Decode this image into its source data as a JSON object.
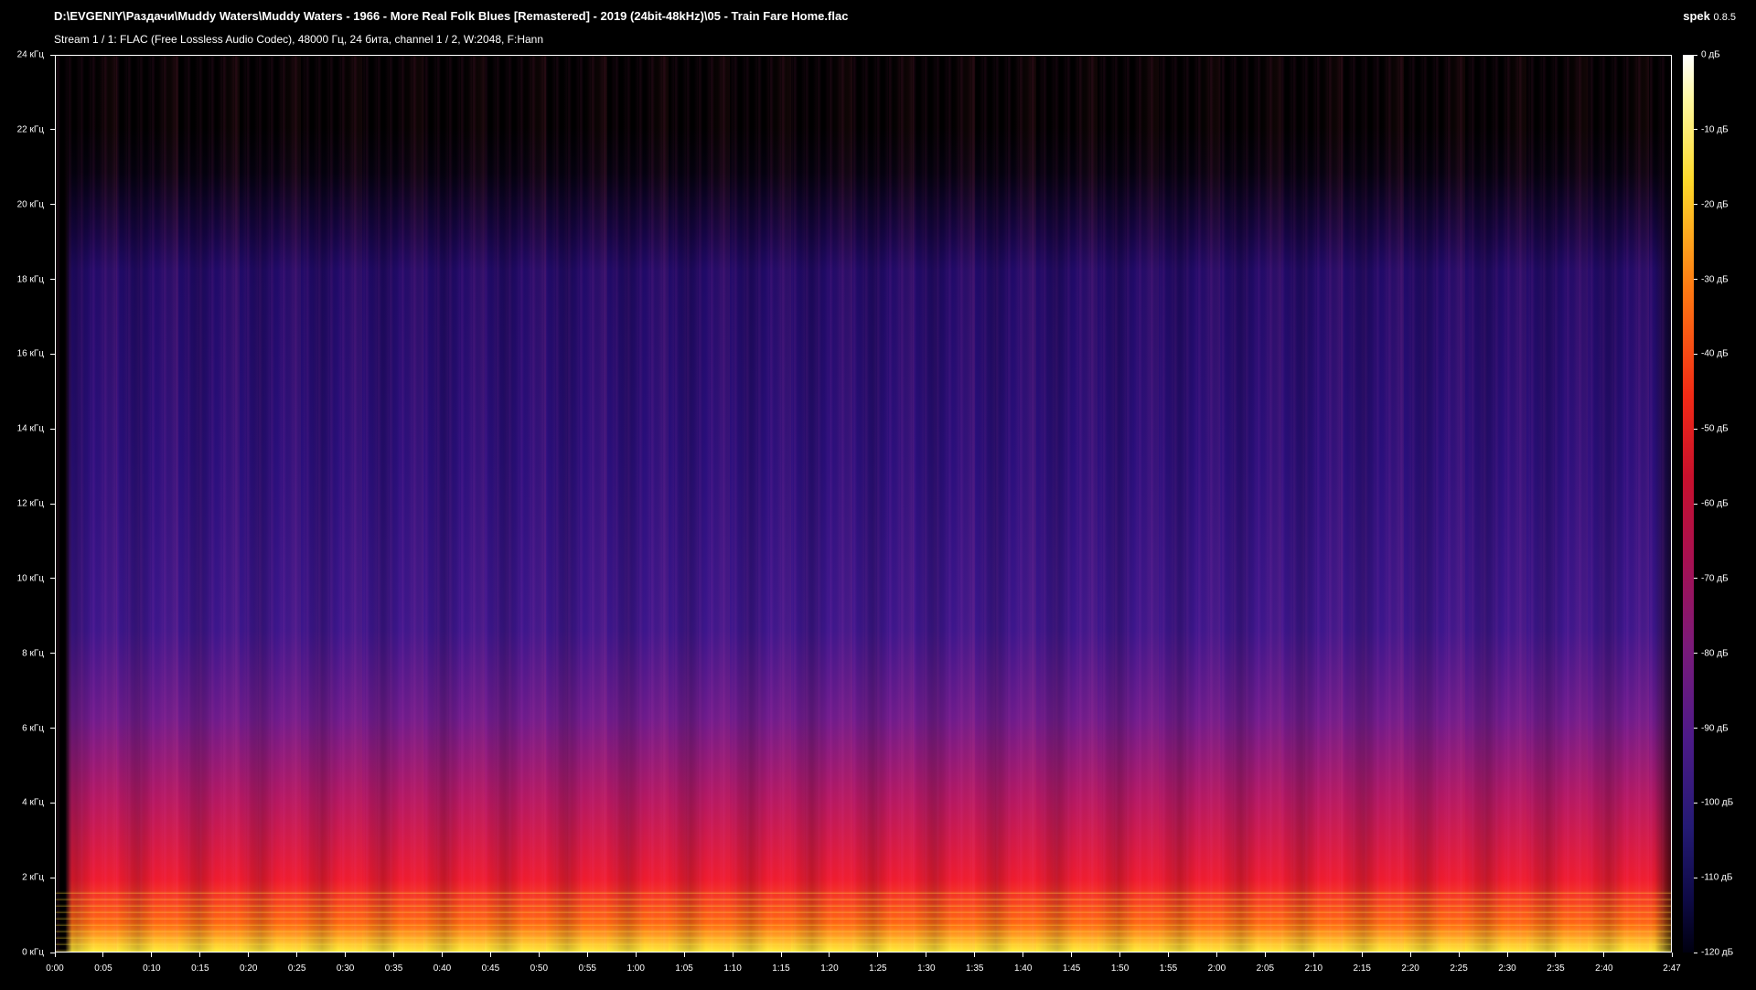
{
  "header": {
    "file_path": "D:\\EVGENIY\\Раздачи\\Muddy Waters\\Muddy Waters - 1966 - More Real Folk Blues [Remastered] - 2019 (24bit-48kHz)\\05 - Train Fare Home.flac",
    "stream_info": "Stream 1 / 1: FLAC (Free Lossless Audio Codec), 48000 Гц, 24 бита, channel 1 / 2, W:2048, F:Hann",
    "app_name": "spek",
    "app_version": "0.8.5"
  },
  "axes": {
    "frequency_labels": [
      "0 кГц",
      "2 кГц",
      "4 кГц",
      "6 кГц",
      "8 кГц",
      "10 кГц",
      "12 кГц",
      "14 кГц",
      "16 кГц",
      "18 кГц",
      "20 кГц",
      "22 кГц",
      "24 кГц"
    ],
    "frequency_range_khz": [
      0,
      24
    ],
    "time_labels": [
      "0:00",
      "0:05",
      "0:10",
      "0:15",
      "0:20",
      "0:25",
      "0:30",
      "0:35",
      "0:40",
      "0:45",
      "0:50",
      "0:55",
      "1:00",
      "1:05",
      "1:10",
      "1:15",
      "1:20",
      "1:25",
      "1:30",
      "1:35",
      "1:40",
      "1:45",
      "1:50",
      "1:55",
      "2:00",
      "2:05",
      "2:10",
      "2:15",
      "2:20",
      "2:25",
      "2:30",
      "2:35",
      "2:40",
      "2:47"
    ],
    "time_seconds": [
      0,
      5,
      10,
      15,
      20,
      25,
      30,
      35,
      40,
      45,
      50,
      55,
      60,
      65,
      70,
      75,
      80,
      85,
      90,
      95,
      100,
      105,
      110,
      115,
      120,
      125,
      130,
      135,
      140,
      145,
      150,
      155,
      160,
      167
    ],
    "duration_seconds": 167,
    "db_labels": [
      "0 дБ",
      "-10 дБ",
      "-20 дБ",
      "-30 дБ",
      "-40 дБ",
      "-50 дБ",
      "-60 дБ",
      "-70 дБ",
      "-80 дБ",
      "-90 дБ",
      "-100 дБ",
      "-110 дБ",
      "-120 дБ"
    ],
    "db_range": [
      -120,
      0
    ]
  },
  "colors": {
    "background": "#000000",
    "text": "#ffffff",
    "frame": "#ffffff"
  }
}
